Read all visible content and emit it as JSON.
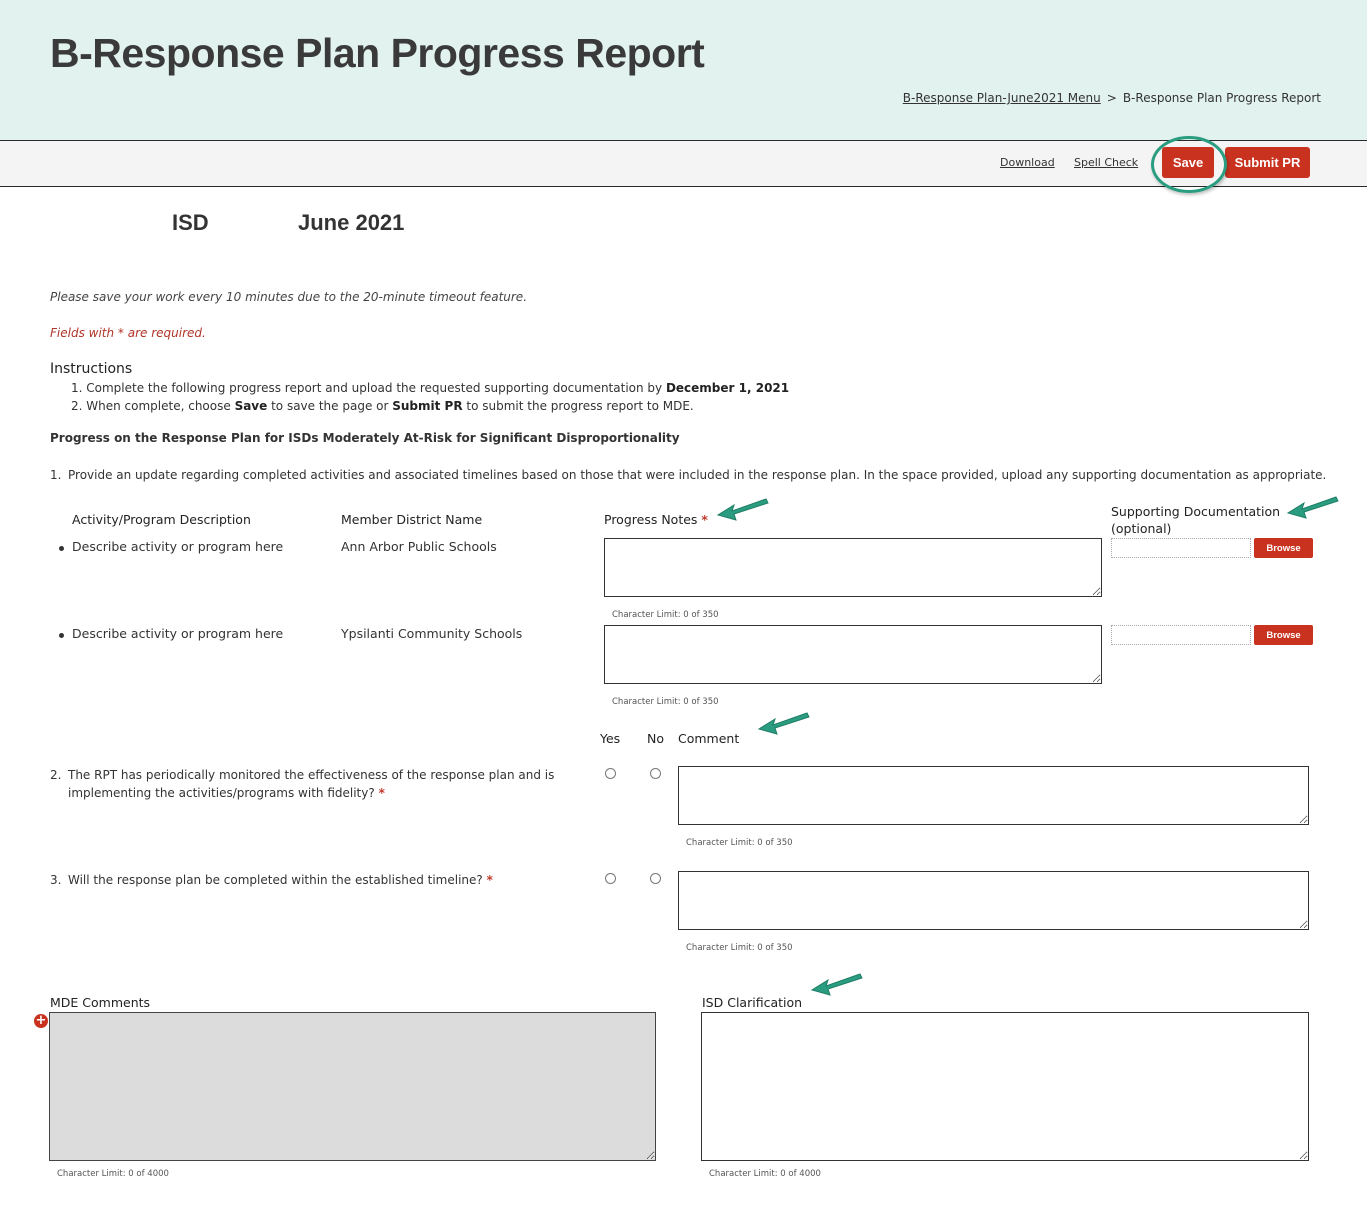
{
  "header": {
    "title": "B-Response Plan Progress Report",
    "breadcrumb": {
      "parent_link": "B-Response Plan-June2021 Menu",
      "separator": ">",
      "current": "B-Response Plan Progress Report"
    }
  },
  "toolbar": {
    "download_label": "Download",
    "spell_check_label": "Spell Check",
    "save_label": "Save",
    "submit_label": "Submit PR"
  },
  "subheader": {
    "entity": "ISD",
    "period": "June 2021"
  },
  "notes": {
    "save_reminder": "Please save your work every 10 minutes due to the 20-minute timeout feature.",
    "required_note": "Fields with * are required."
  },
  "instructions": {
    "title": "Instructions",
    "items": [
      {
        "prefix": "1. Complete the following progress report and upload the requested supporting documentation by ",
        "bold": "December 1, 2021",
        "suffix": ""
      },
      {
        "prefix": "2. When complete, choose ",
        "bold": "Save",
        "middle": " to save the page or ",
        "bold2": "Submit PR",
        "suffix": " to submit the progress report to MDE."
      }
    ]
  },
  "section_title": "Progress on the Response Plan for ISDs Moderately At-Risk for Significant Disproportionality",
  "question1": {
    "number": "1.",
    "text": "Provide an update regarding completed activities and associated timelines based on those that were included in the response plan. In the space provided, upload any supporting documentation as appropriate.",
    "columns": {
      "activity": "Activity/Program Description",
      "district": "Member District Name",
      "progress_notes": "Progress Notes",
      "required_mark": "*",
      "supporting_doc": "Supporting Documentation",
      "supporting_doc_sub": "(optional)"
    },
    "rows": [
      {
        "activity": "Describe activity or program here",
        "district": "Ann Arbor Public Schools",
        "notes_value": "",
        "char_limit": "Character Limit: 0 of 350",
        "file_value": "",
        "browse_label": "Browse"
      },
      {
        "activity": "Describe activity or program here",
        "district": "Ypsilanti Community Schools",
        "notes_value": "",
        "char_limit": "Character Limit: 0 of 350",
        "file_value": "",
        "browse_label": "Browse"
      }
    ]
  },
  "yes_no_header": {
    "yes": "Yes",
    "no": "No",
    "comment": "Comment"
  },
  "question2": {
    "number": "2.",
    "line1": "The RPT has periodically monitored the effectiveness of the response plan and is",
    "line2": "implementing the activities/programs with fidelity?",
    "required_mark": "*",
    "selected": null,
    "comment_value": "",
    "char_limit": "Character Limit: 0 of 350"
  },
  "question3": {
    "number": "3.",
    "text": "Will the response plan be completed within the established timeline?",
    "required_mark": "*",
    "selected": null,
    "comment_value": "",
    "char_limit": "Character Limit: 0 of 350"
  },
  "mde_comments": {
    "label": "MDE Comments",
    "value": "",
    "char_limit": "Character Limit: 0 of 4000"
  },
  "isd_clarification": {
    "label": "ISD Clarification",
    "value": "",
    "char_limit": "Character Limit: 0 of 4000"
  },
  "colors": {
    "header_bg": "#e2f3ef",
    "accent_red": "#c8321f",
    "annotation_green": "#2a9d80",
    "required_red": "#c0392b"
  }
}
